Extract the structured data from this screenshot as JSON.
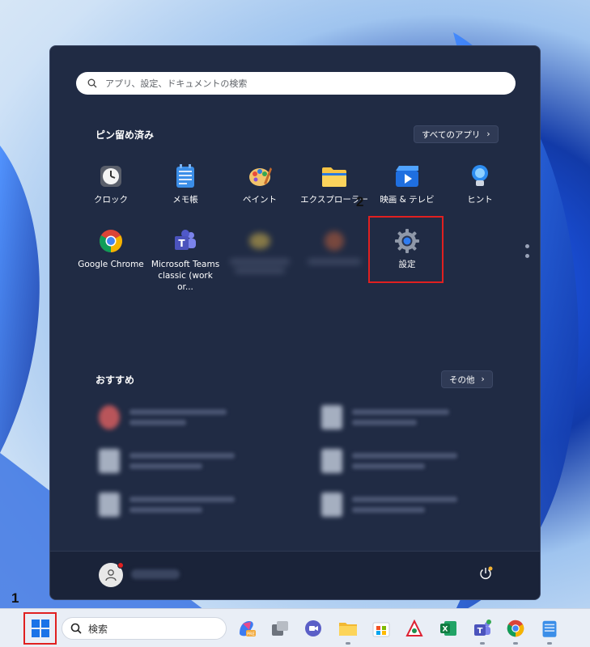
{
  "start_menu": {
    "search_placeholder": "アプリ、設定、ドキュメントの検索",
    "pinned_title": "ピン留め済み",
    "all_apps_label": "すべてのアプリ",
    "pinned_apps": [
      {
        "label": "クロック",
        "icon": "clock-icon"
      },
      {
        "label": "メモ帳",
        "icon": "notepad-icon"
      },
      {
        "label": "ペイント",
        "icon": "paint-icon"
      },
      {
        "label": "エクスプローラー",
        "icon": "folder-icon"
      },
      {
        "label": "映画 & テレビ",
        "icon": "movies-tv-icon"
      },
      {
        "label": "ヒント",
        "icon": "tips-icon"
      },
      {
        "label": "Google Chrome",
        "icon": "chrome-icon"
      },
      {
        "label": "Microsoft Teams classic (work or...",
        "icon": "teams-icon"
      },
      {
        "label": "設定",
        "icon": "settings-gear-icon"
      }
    ],
    "recommended_title": "おすすめ",
    "more_label": "その他"
  },
  "taskbar": {
    "search_placeholder": "検索",
    "icons": [
      "copilot-icon",
      "task-view-icon",
      "meet-icon",
      "file-explorer-icon",
      "store-icon",
      "snipping-icon",
      "excel-icon",
      "teams-icon",
      "chrome-icon",
      "notepad-icon"
    ]
  },
  "annotations": {
    "step1": "1",
    "step2": "2",
    "highlight_color": "#e02020"
  },
  "colors": {
    "start_bg": "#202b44",
    "accent": "#0a64d8"
  }
}
